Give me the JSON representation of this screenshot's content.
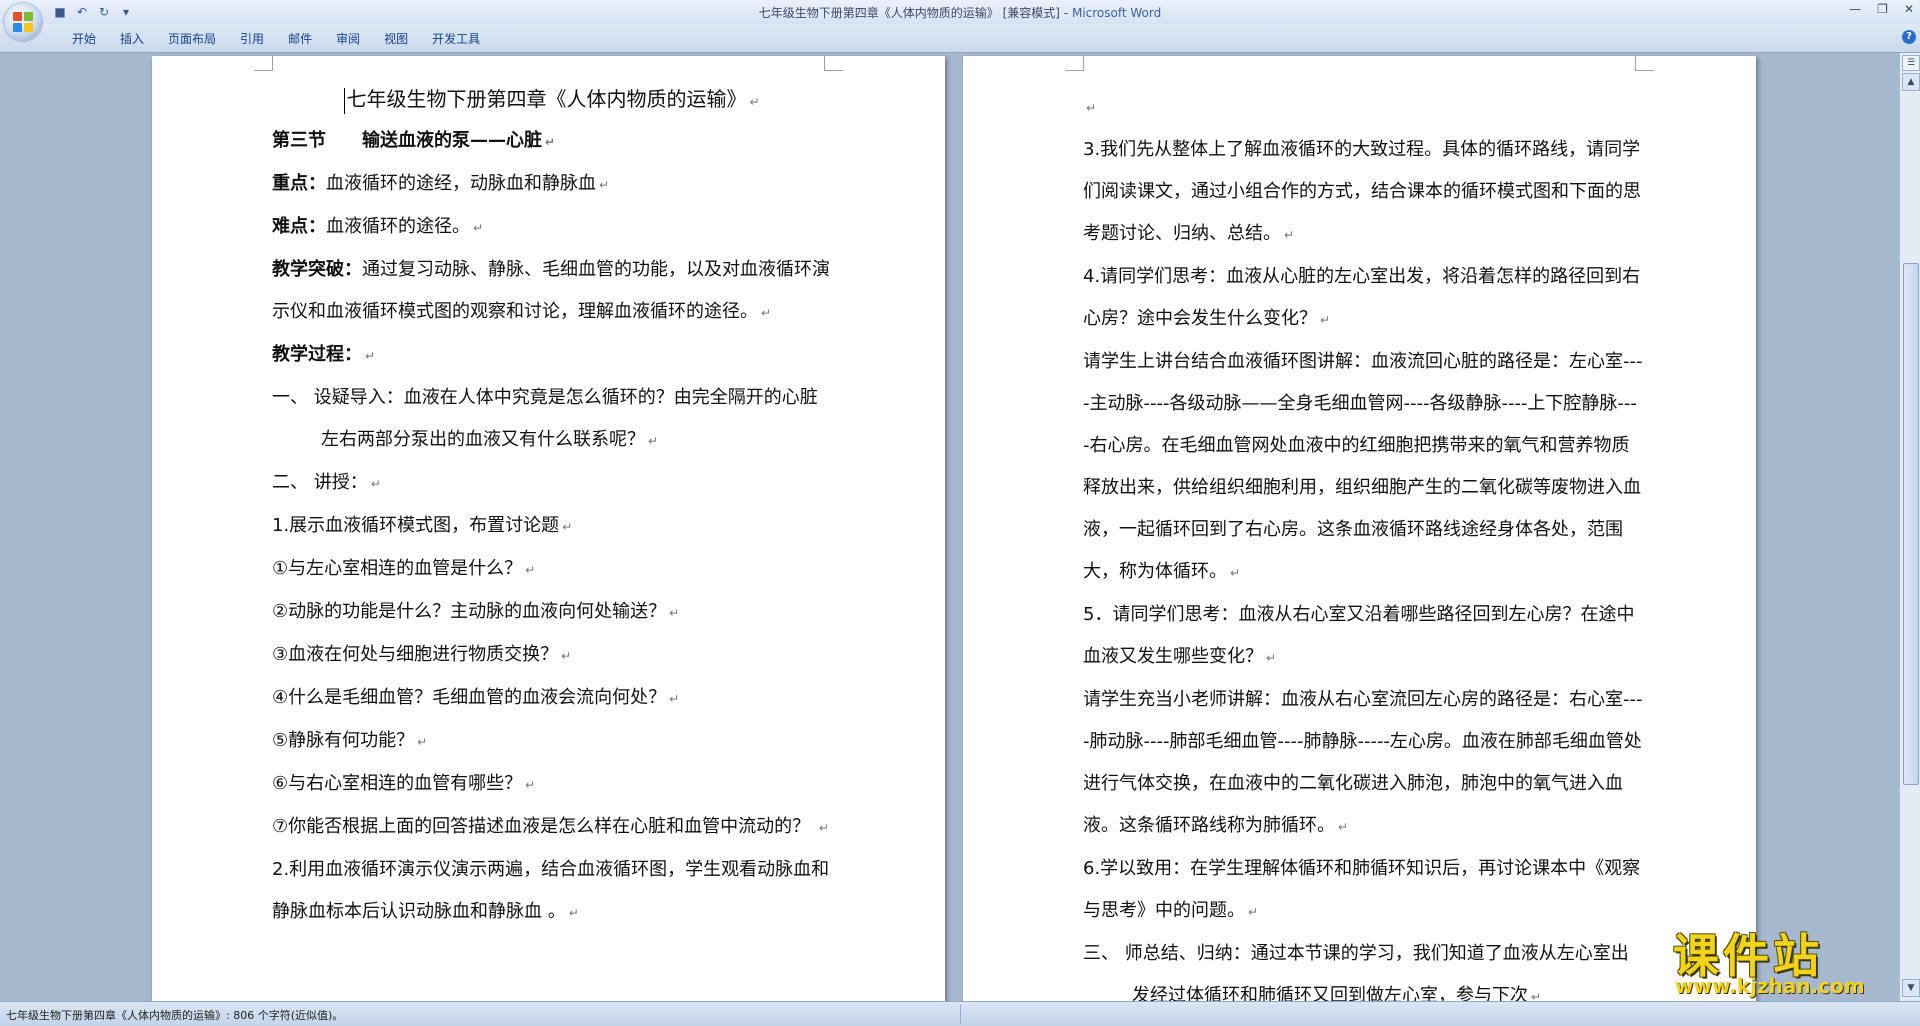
{
  "window": {
    "doc_title": "七年级生物下册第四章《人体内物质的运输》 [兼容模式]",
    "separator": " - ",
    "app_name": "Microsoft Word"
  },
  "ribbon": {
    "tabs": [
      "开始",
      "插入",
      "页面布局",
      "引用",
      "邮件",
      "审阅",
      "视图",
      "开发工具"
    ]
  },
  "left_page": [
    {
      "type": "title",
      "text": "七年级生物下册第四章《人体内物质的运输》"
    },
    {
      "type": "section",
      "label": "第三节",
      "text": "输送血液的泵——心脏"
    },
    {
      "type": "labeled",
      "label": "重点：",
      "text": "血液循环的途经，动脉血和静脉血"
    },
    {
      "type": "labeled",
      "label": "难点：",
      "text": "血液循环的途径。"
    },
    {
      "type": "labeled",
      "label": "教学突破：",
      "text": "通过复习动脉、静脉、毛细血管的功能，以及对血液循环演示仪和血液循环模式图的观察和讨论，理解血液循环的途径。"
    },
    {
      "type": "labeled",
      "label": "教学过程：",
      "text": ""
    },
    {
      "type": "hang",
      "text": "一、  设疑导入：血液在人体中究竟是怎么循环的？由完全隔开的心脏左右两部分泵出的血液又有什么联系呢？"
    },
    {
      "type": "hang",
      "text": "二、  讲授："
    },
    {
      "type": "plain",
      "text": "1.展示血液循环模式图，布置讨论题"
    },
    {
      "type": "plain",
      "text": "①与左心室相连的血管是什么？"
    },
    {
      "type": "plain",
      "text": "②动脉的功能是什么？主动脉的血液向何处输送？"
    },
    {
      "type": "plain",
      "text": "③血液在何处与细胞进行物质交换？"
    },
    {
      "type": "plain",
      "text": "④什么是毛细血管？毛细血管的血液会流向何处？"
    },
    {
      "type": "plain",
      "text": "⑤静脉有何功能？"
    },
    {
      "type": "plain",
      "text": "⑥与右心室相连的血管有哪些？"
    },
    {
      "type": "plain",
      "text": "⑦你能否根据上面的回答描述血液是怎么样在心脏和血管中流动的？  "
    },
    {
      "type": "plain",
      "text": "2.利用血液循环演示仪演示两遍，结合血液循环图，学生观看动脉血和静脉血标本后认识动脉血和静脉血  。"
    }
  ],
  "right_page": [
    {
      "type": "plain",
      "text": ""
    },
    {
      "type": "plain",
      "text": "3.我们先从整体上了解血液循环的大致过程。具体的循环路线，请同学们阅读课文，通过小组合作的方式，结合课本的循环模式图和下面的思考题讨论、归纳、总结。"
    },
    {
      "type": "plain",
      "text": "4.请同学们思考：血液从心脏的左心室出发，将沿着怎样的路径回到右心房？途中会发生什么变化？"
    },
    {
      "type": "plain",
      "text": "请学生上讲台结合血液循环图讲解：血液流回心脏的路径是：左心室----主动脉----各级动脉——全身毛细血管网----各级静脉----上下腔静脉----右心房。在毛细血管网处血液中的红细胞把携带来的氧气和营养物质释放出来，供给组织细胞利用，组织细胞产生的二氧化碳等废物进入血液，一起循环回到了右心房。这条血液循环路线途经身体各处，范围大，称为体循环。"
    },
    {
      "type": "plain",
      "text": "5．请同学们思考：血液从右心室又沿着哪些路径回到左心房？在途中血液又发生哪些变化？"
    },
    {
      "type": "plain",
      "text": "请学生充当小老师讲解：血液从右心室流回左心房的路径是：右心室----肺动脉----肺部毛细血管----肺静脉-----左心房。血液在肺部毛细血管处进行气体交换，在血液中的二氧化碳进入肺泡，肺泡中的氧气进入血液。这条循环路线称为肺循环。"
    },
    {
      "type": "plain",
      "text": "6.学以致用：在学生理解体循环和肺循环知识后，再讨论课本中《观察与思考》中的问题。"
    },
    {
      "type": "hang",
      "text": "三、  师总结、归纳：通过本节课的学习，我们知道了血液从左心室出发经过体循环和肺循环又回到做左心室，参与下次"
    }
  ],
  "status": {
    "text": "七年级生物下册第四章《人体内物质的运输》: 806 个字符(近似值)。"
  },
  "watermark": {
    "main": "课件站",
    "url": "www.kjzhan.com"
  }
}
